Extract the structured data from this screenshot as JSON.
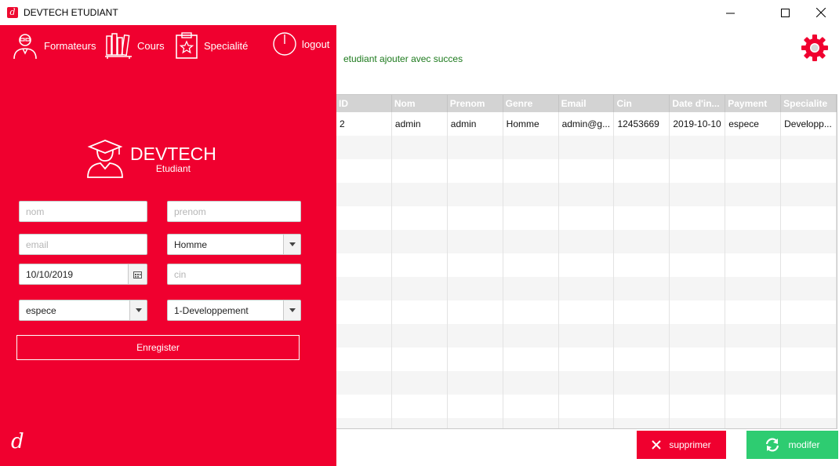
{
  "window": {
    "title": "DEVTECH ETUDIANT"
  },
  "nav": {
    "formateurs": "Formateurs",
    "cours": "Cours",
    "specialite": "Specialité",
    "logout": "logout"
  },
  "brand": {
    "title": "DEVTECH",
    "subtitle": "Etudiant"
  },
  "form": {
    "nom_placeholder": "nom",
    "prenom_placeholder": "prenom",
    "email_placeholder": "email",
    "genre_value": "Homme",
    "date_value": "10/10/2019",
    "cin_placeholder": "cin",
    "payment_value": "espece",
    "specialite_value": "1-Developpement",
    "save_label": "Enregister"
  },
  "status": {
    "message": "etudiant ajouter avec succes",
    "color": "#1d7a1d"
  },
  "table": {
    "columns": [
      "ID",
      "Nom",
      "Prenom",
      "Genre",
      "Email",
      "Cin",
      "Date d'in...",
      "Payment",
      "Specialite"
    ],
    "rows": [
      [
        "2",
        "admin",
        "admin",
        "Homme",
        "admin@g...",
        "12453669",
        "2019-10-10",
        "espece",
        "Developp..."
      ]
    ],
    "empty_rows": 13
  },
  "actions": {
    "delete_label": "supprimer",
    "modify_label": "modifer"
  },
  "colors": {
    "accent": "#f0002f",
    "success": "#2ecc71"
  }
}
